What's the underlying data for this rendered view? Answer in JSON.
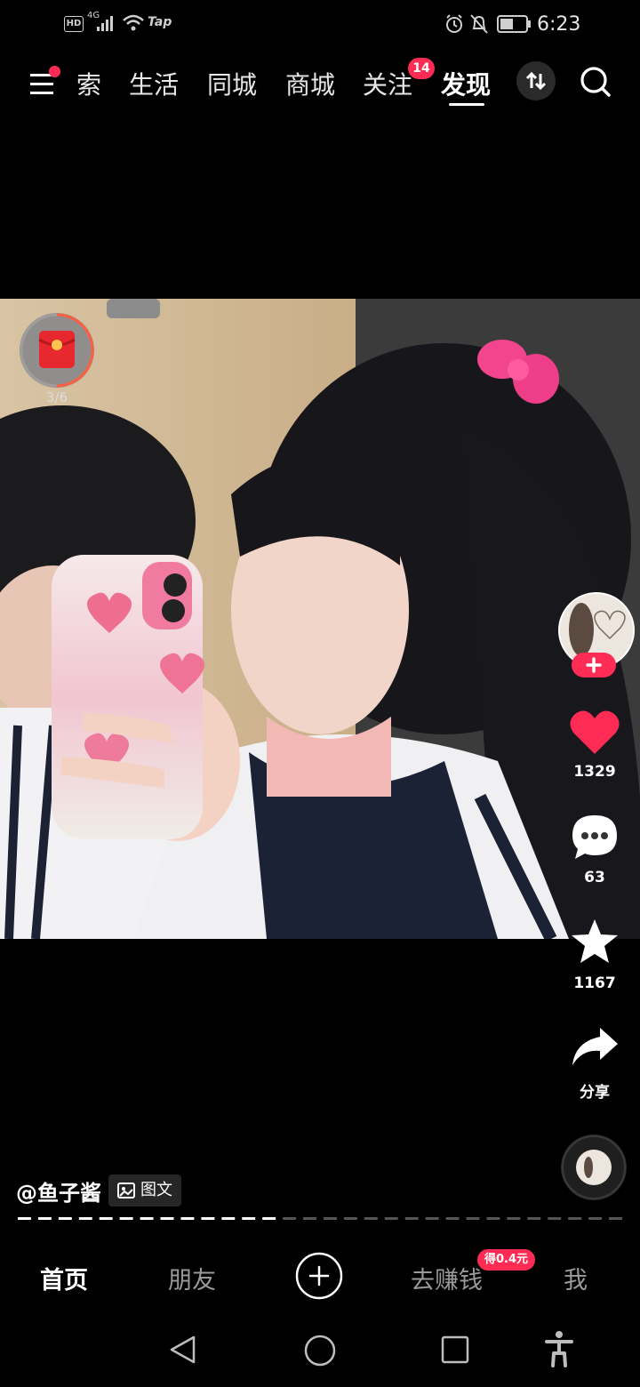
{
  "status_bar": {
    "left_icons": [
      "HD",
      "4G",
      "signal-icon",
      "wifi-icon",
      "Tap"
    ],
    "right_icons": [
      "alarm-icon",
      "mute-icon",
      "battery-icon"
    ],
    "time": "6:23"
  },
  "top_nav": {
    "menu_icon": "menu-icon",
    "tabs": [
      {
        "label": "索"
      },
      {
        "label": "生活"
      },
      {
        "label": "同城"
      },
      {
        "label": "商城"
      },
      {
        "label": "关注",
        "badge": "14"
      },
      {
        "label": "发现",
        "active": true
      }
    ],
    "switch_icon": "swap-icon",
    "search_icon": "search-icon"
  },
  "red_packet": {
    "icon": "red-packet-icon",
    "count": "3/6",
    "progress": 0.5
  },
  "right_rail": {
    "avatar_icon": "author-avatar",
    "follow_icon": "plus-icon",
    "like_count": "1329",
    "comment_count": "63",
    "favorite_count": "1167",
    "share_label": "分享",
    "music_icon": "music-disc-icon"
  },
  "post": {
    "author": "@鱼子酱",
    "type_label": "图文",
    "image_index": 13,
    "image_total": 30
  },
  "bottom_nav": {
    "items": [
      {
        "label": "首页",
        "active": true
      },
      {
        "label": "朋友"
      },
      {
        "label": "去赚钱",
        "badge": "得0.4元"
      },
      {
        "label": "我"
      }
    ],
    "create_icon": "plus-circle-icon"
  },
  "system_nav": [
    "back-icon",
    "home-icon",
    "recents-icon",
    "accessibility-icon"
  ],
  "colors": {
    "accent": "#fe2c55",
    "like": "#fe2c55",
    "background": "#000000"
  }
}
